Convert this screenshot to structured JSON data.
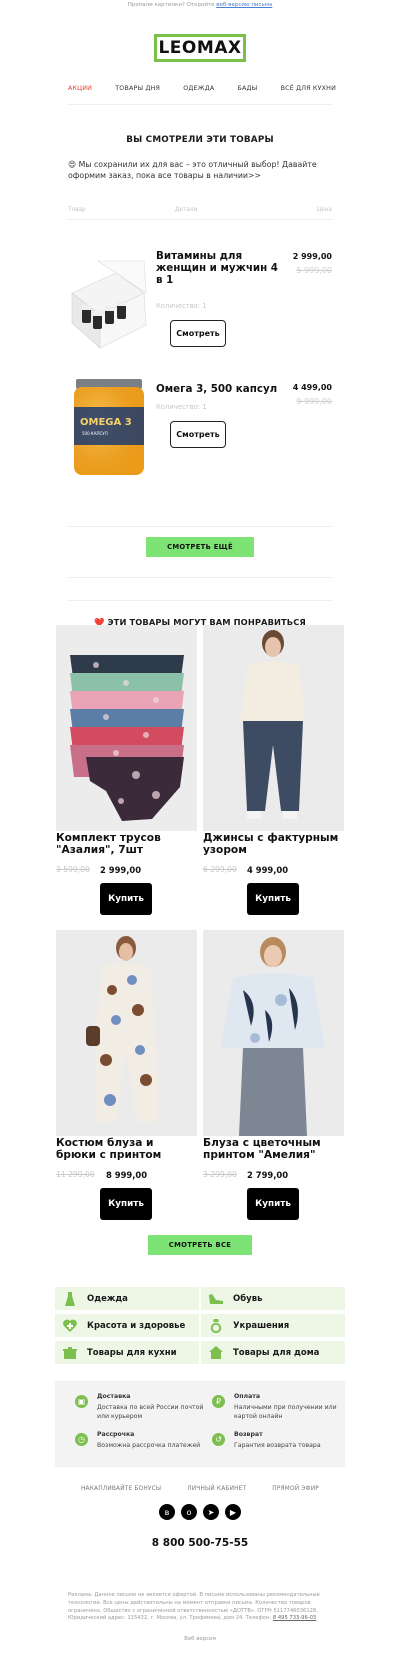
{
  "preheader": {
    "text": "Пропали картинки? Откройте ",
    "link": "веб-версию письма"
  },
  "brand": {
    "logo": "LEOMAX",
    "accent": "#79c04b"
  },
  "nav": [
    "АКЦИИ",
    "ТОВАРЫ ДНЯ",
    "ОДЕЖДА",
    "БАДЫ",
    "ВСЁ ДЛЯ КУХНИ"
  ],
  "viewed": {
    "title": "ВЫ СМОТРЕЛИ ЭТИ ТОВАРЫ",
    "intro": "😍 Мы сохранили их для вас – это отличный выбор! Давайте оформим заказ, пока все товары в наличии>>",
    "headers": [
      "Товар",
      "Детали",
      "Цена"
    ],
    "items": [
      {
        "name": "Витамины для женщин и мужчин 4 в 1",
        "qty": "Количество: 1",
        "price": "2 999,00",
        "old": "5 999,00",
        "btn": "Смотреть"
      },
      {
        "name": "Омега 3, 500 капсул",
        "qty": "Количество: 1",
        "price": "4 499,00",
        "old": "9 999,00",
        "btn": "Смотреть"
      }
    ],
    "more": "СМОТРЕТЬ ЕЩЁ"
  },
  "liked": {
    "title": "❤️ ЭТИ ТОВАРЫ МОГУТ ВАМ ПОНРАВИТЬСЯ",
    "items": [
      {
        "name": "Комплект трусов \"Азалия\", 7шт",
        "old": "3 599,00",
        "price": "2 999,00",
        "btn": "Купить"
      },
      {
        "name": "Джинсы с фактурным узором",
        "old": "6 299,00",
        "price": "4 999,00",
        "btn": "Купить"
      },
      {
        "name": "Костюм блуза и брюки с принтом",
        "old": "11 299,00",
        "price": "8 999,00",
        "btn": "Купить"
      },
      {
        "name": "Блуза с цветочным принтом \"Амелия\"",
        "old": "3 299,00",
        "price": "2 799,00",
        "btn": "Купить"
      }
    ],
    "all": "СМОТРЕТЬ ВСЕ"
  },
  "categories": [
    {
      "label": "Одежда",
      "icon": "dress-icon"
    },
    {
      "label": "Обувь",
      "icon": "shoe-icon"
    },
    {
      "label": "Красота и здоровье",
      "icon": "heart-plus-icon"
    },
    {
      "label": "Украшения",
      "icon": "ring-icon"
    },
    {
      "label": "Товары для кухни",
      "icon": "pot-icon"
    },
    {
      "label": "Товары для дома",
      "icon": "house-icon"
    }
  ],
  "benefits": [
    {
      "title": "Доставка",
      "desc": "Доставка по всей России почтой или курьером",
      "icon": "box-icon"
    },
    {
      "title": "Оплата",
      "desc": "Наличными при получении или картой онлайн",
      "icon": "ruble-icon"
    },
    {
      "title": "Рассрочка",
      "desc": "Возможна рассрочка платежей",
      "icon": "clock-icon"
    },
    {
      "title": "Возврат",
      "desc": "Гарантия возврата товара",
      "icon": "return-icon"
    }
  ],
  "footer_links": [
    "НАКАПЛИВАЙТЕ БОНУСЫ",
    "ЛИЧНЫЙ КАБИНЕТ",
    "ПРЯМОЙ ЭФИР"
  ],
  "phone": "8 800 500-75-55",
  "legal": "Реклама. Данное письмо не является офертой. В письме использованы рекомендательные технологии. Все цены действительны на момент отправки письма. Количество товаров ограничено. Общество с ограниченной ответственностью «ДОТТВ». ОГРН 5117746036128. Юридический адрес: 115432, г. Москва, ул. Трофимова, дом 24. Телефон: ",
  "legal_phone": "8 495 733-96-03",
  "web_version": "Веб версия"
}
